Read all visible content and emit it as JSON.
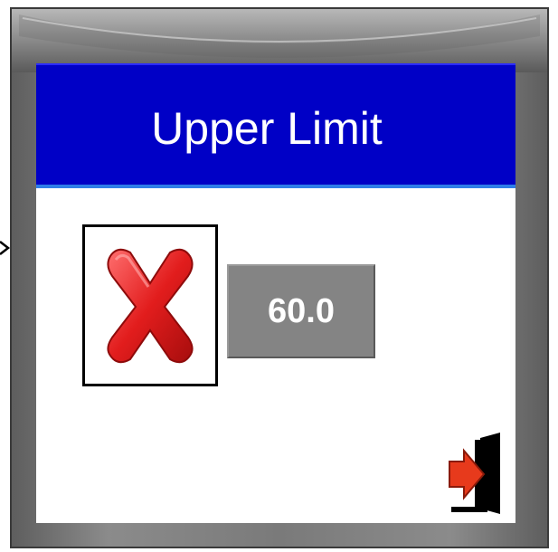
{
  "dialog": {
    "title": "Upper Limit"
  },
  "limit": {
    "value": "60.0"
  },
  "icons": {
    "edge_arrow": "chevron-right-icon",
    "cancel": "x-icon",
    "exit": "exit-door-icon"
  },
  "colors": {
    "title_bar": "#0000c6",
    "title_border": "#2e7ee8",
    "value_box": "#848484",
    "frame": "#7a7a7a",
    "x_red": "#e62020"
  }
}
